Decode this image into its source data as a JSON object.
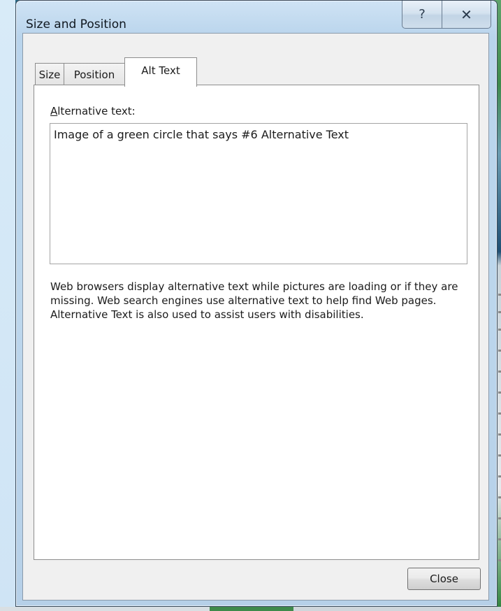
{
  "window": {
    "title": "Size and Position",
    "help_glyph": "?",
    "close_glyph": "✕"
  },
  "tabs": [
    {
      "label": "Size",
      "active": false
    },
    {
      "label": "Position",
      "active": false
    },
    {
      "label": "Alt Text",
      "active": true
    }
  ],
  "alt_text": {
    "label_accel": "A",
    "label_rest": "lternative text:",
    "value": "Image of a green circle that says #6 Alternative Text"
  },
  "description": "Web browsers display alternative text while pictures are loading or if they are missing.  Web search engines use alternative text to help find Web pages.  Alternative Text is also used to assist users with disabilities.",
  "buttons": {
    "close_label": "Close"
  }
}
